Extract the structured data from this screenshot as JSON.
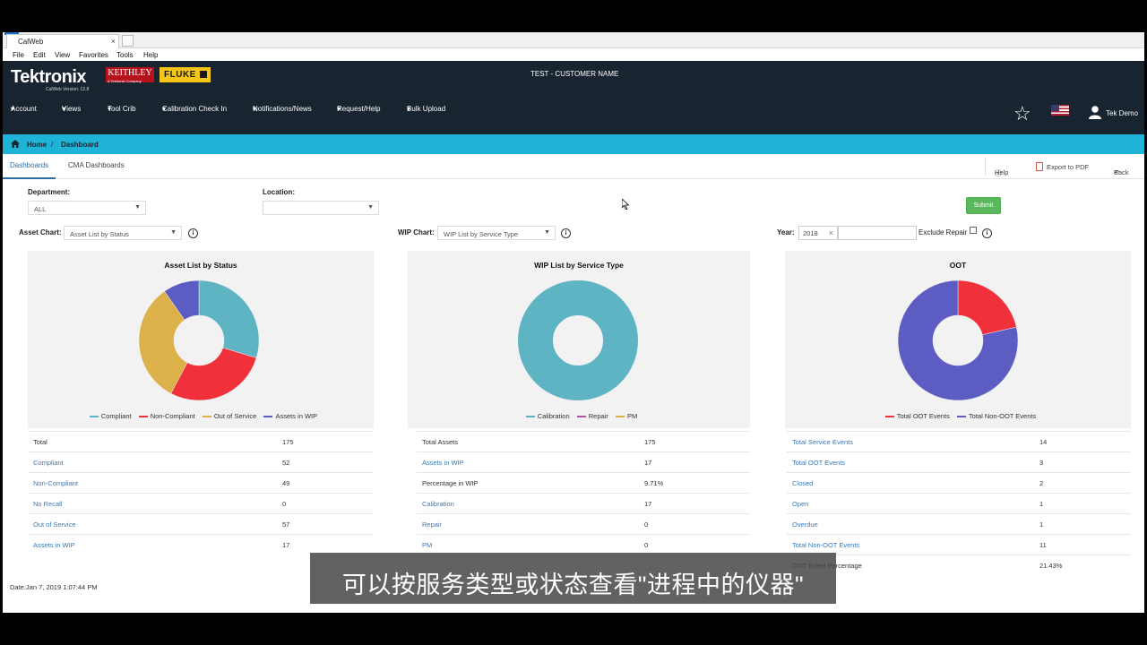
{
  "browser": {
    "tab_title": "CalWeb",
    "tab_close": "×",
    "menu": [
      "File",
      "Edit",
      "View",
      "Favorites",
      "Tools",
      "Help"
    ]
  },
  "header": {
    "brand": "Tektronix",
    "version": "CalWeb Version: 12.8",
    "keithley": "KEITHLEY",
    "keithley_sub": "A Tektronix Company",
    "fluke": "FLUKE",
    "customer": "TEST - CUSTOMER NAME",
    "nav": [
      "Account",
      "Views",
      "Tool Crib",
      "Calibration Check In",
      "Notifications/News",
      "Request/Help",
      "Bulk Upload"
    ],
    "user": "Tek Demo"
  },
  "breadcrumb": {
    "home": "Home",
    "sep": "/",
    "current": "Dashboard"
  },
  "tabs": {
    "dashboards": "Dashboards",
    "cma": "CMA Dashboards"
  },
  "toolbar": {
    "help": "Help",
    "export": "Export to PDF",
    "back": "Back"
  },
  "filters": {
    "department_label": "Department:",
    "department_value": "ALL",
    "location_label": "Location:",
    "location_value": "",
    "submit": "Submit",
    "asset_chart_label": "Asset Chart:",
    "asset_chart_value": "Asset List by Status",
    "wip_chart_label": "WIP Chart:",
    "wip_chart_value": "WIP List by Service Type",
    "year_label": "Year:",
    "year_value": "2018",
    "exclude_repair_label": "Exclude Repair"
  },
  "colors": {
    "teal": "#5fb4c4",
    "red": "#f0303a",
    "gold": "#dcb14a",
    "blue": "#5c5cc2",
    "purple": "#b04fa8"
  },
  "chart_data": [
    {
      "type": "pie",
      "title": "Asset List by Status",
      "categories": [
        "Compliant",
        "Non-Compliant",
        "Out of Service",
        "Assets in WIP"
      ],
      "values": [
        52,
        49,
        57,
        17
      ],
      "colors": [
        "#5fb4c4",
        "#f0303a",
        "#dcb14a",
        "#5c5cc2"
      ]
    },
    {
      "type": "pie",
      "title": "WIP List by Service Type",
      "categories": [
        "Calibration",
        "Repair",
        "PM"
      ],
      "values": [
        17,
        0,
        0
      ],
      "colors": [
        "#5fb4c4",
        "#b04fa8",
        "#dcb14a"
      ]
    },
    {
      "type": "pie",
      "title": "OOT",
      "categories": [
        "Total OOT Events",
        "Total Non-OOT Events"
      ],
      "values": [
        3,
        11
      ],
      "colors": [
        "#f0303a",
        "#5c5cc2"
      ]
    }
  ],
  "tables": [
    {
      "rows": [
        {
          "label": "Total",
          "value": "175",
          "link": false
        },
        {
          "label": "Compliant",
          "value": "52",
          "link": true
        },
        {
          "label": "Non-Compliant",
          "value": "49",
          "link": true
        },
        {
          "label": "No Recall",
          "value": "0",
          "link": true
        },
        {
          "label": "Out of Service",
          "value": "57",
          "link": true
        },
        {
          "label": "Assets in WIP",
          "value": "17",
          "link": true
        }
      ]
    },
    {
      "rows": [
        {
          "label": "Total Assets",
          "value": "175",
          "link": false
        },
        {
          "label": "Assets in WIP",
          "value": "17",
          "link": true
        },
        {
          "label": "Percentage in WIP",
          "value": "9.71%",
          "link": false
        },
        {
          "label": "Calibration",
          "value": "17",
          "link": true
        },
        {
          "label": "Repair",
          "value": "0",
          "link": true
        },
        {
          "label": "PM",
          "value": "0",
          "link": true
        }
      ]
    },
    {
      "rows": [
        {
          "label": "Total Service Events",
          "value": "14",
          "link": true
        },
        {
          "label": "Total OOT Events",
          "value": "3",
          "link": true
        },
        {
          "label": "Closed",
          "value": "2",
          "link": true
        },
        {
          "label": "Open",
          "value": "1",
          "link": true
        },
        {
          "label": "Overdue",
          "value": "1",
          "link": true
        },
        {
          "label": "Total Non-OOT Events",
          "value": "11",
          "link": true
        },
        {
          "label": "OOT Event Percentage",
          "value": "21.43%",
          "link": false
        }
      ]
    }
  ],
  "footer_date": "Date:Jan 7, 2019 1:07:44 PM",
  "subtitle": "可以按服务类型或状态查看\"进程中的仪器\""
}
